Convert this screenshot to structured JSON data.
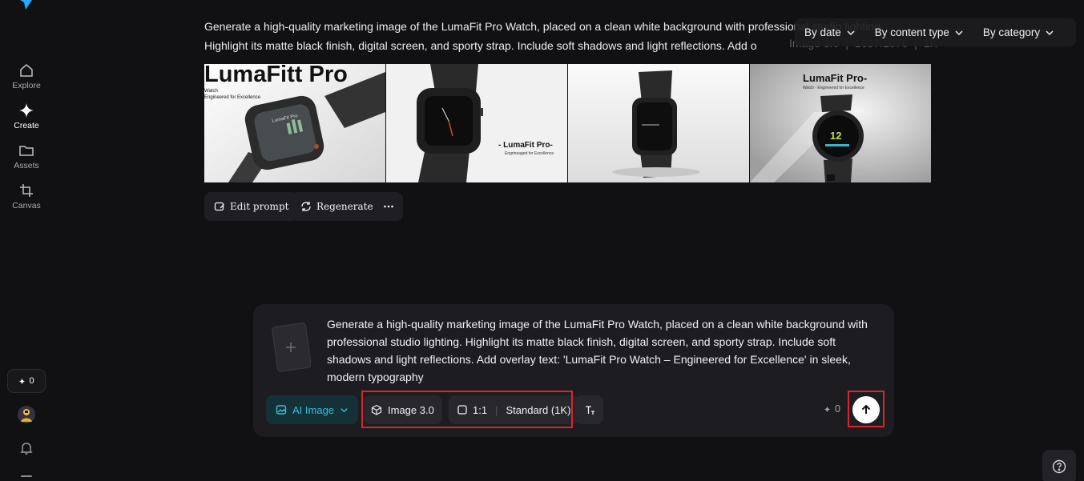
{
  "sidebar": {
    "items": [
      {
        "label": "Explore",
        "icon": "home-icon"
      },
      {
        "label": "Create",
        "icon": "sparkle-icon"
      },
      {
        "label": "Assets",
        "icon": "folder-icon"
      },
      {
        "label": "Canvas",
        "icon": "canvas-crop-icon"
      }
    ],
    "credits": "0"
  },
  "filters": {
    "date": "By date",
    "content_type": "By content type",
    "category": "By category"
  },
  "generation": {
    "prompt": "Generate a high-quality marketing image of the LumaFit Pro Watch, placed on a clean white background with professional studio lighting. Highlight its matte black finish, digital screen, and sporty strap. Include soft shadows and light reflections. Add o",
    "model": "Image 3.0",
    "resolution": "1637:1076",
    "quality": "1K"
  },
  "images": [
    {
      "title": "LumaFitt Pro",
      "sub1": "Watch",
      "sub2": "Engineered for Excellence",
      "screen_text": "LumaFit Pro"
    },
    {
      "title": "- LumaFit Pro-",
      "sub1": "Engrineaged for Excellence"
    },
    {
      "title": ""
    },
    {
      "title": "LumaFit Pro-",
      "sub1": "Watch - Engineered for Excellence",
      "screen_text": "12"
    }
  ],
  "actions": {
    "edit_prompt": "Edit prompt",
    "regenerate": "Regenerate"
  },
  "composer": {
    "prompt": "Generate a high-quality marketing image of the LumaFit Pro Watch, placed on a clean white background with professional studio lighting. Highlight its matte black finish, digital screen, and sporty strap. Include soft shadows and light reflections. Add overlay text: 'LumaFit Pro Watch – Engineered for Excellence' in sleek, modern typography",
    "mode": "AI Image",
    "model": "Image 3.0",
    "ratio": "1:1",
    "quality": "Standard (1K)",
    "cost": "0"
  },
  "colors": {
    "accent": "#2dc3dc",
    "highlight_outline": "#d7262e",
    "background": "#111113"
  }
}
